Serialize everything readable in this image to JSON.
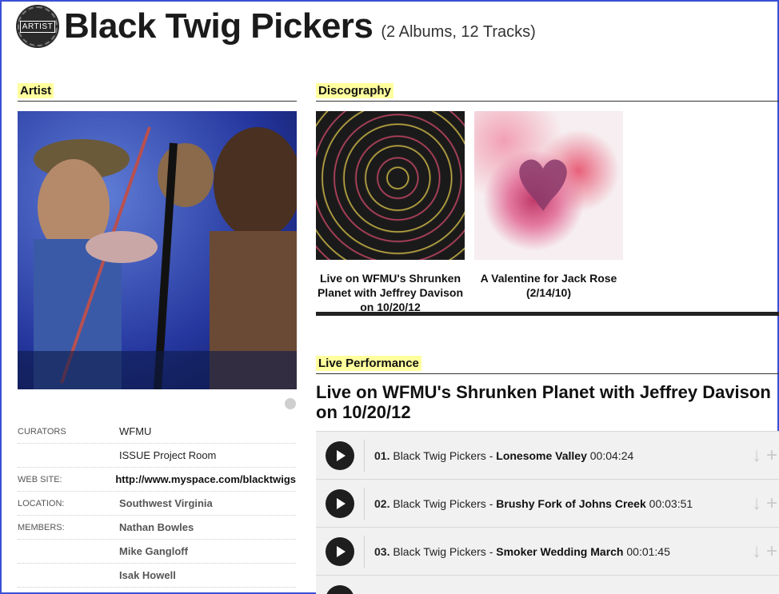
{
  "header": {
    "badge": "ARTIST",
    "title": "Black Twig Pickers",
    "counts": "(2 Albums, 12 Tracks)"
  },
  "sections": {
    "artist": "Artist",
    "discography": "Discography",
    "live": "Live Performance"
  },
  "info": [
    {
      "label": "CURATORS",
      "value": "WFMU"
    },
    {
      "label": "",
      "value": "ISSUE Project Room"
    },
    {
      "label": "WEB SITE:",
      "value": "http://www.myspace.com/blacktwigs"
    },
    {
      "label": "LOCATION:",
      "value": "Southwest Virginia"
    },
    {
      "label": "MEMBERS:",
      "value": "Nathan Bowles"
    },
    {
      "label": "",
      "value": "Mike Gangloff"
    },
    {
      "label": "",
      "value": "Isak Howell"
    }
  ],
  "albums": [
    {
      "title": "Live on WFMU's Shrunken Planet with Jeffrey Davison on 10/20/12"
    },
    {
      "title": "A Valentine for Jack Rose (2/14/10)"
    }
  ],
  "live_title": "Live on WFMU's Shrunken Planet with Jeffrey Davison on 10/20/12",
  "tracks": [
    {
      "num": "01.",
      "artist": "Black Twig Pickers",
      "sep": " - ",
      "name": "Lonesome Valley",
      "duration": "00:04:24"
    },
    {
      "num": "02.",
      "artist": "Black Twig Pickers",
      "sep": " - ",
      "name": "Brushy Fork of Johns Creek",
      "duration": "00:03:51"
    },
    {
      "num": "03.",
      "artist": "Black Twig Pickers",
      "sep": " - ",
      "name": "Smoker Wedding March",
      "duration": "00:01:45"
    }
  ],
  "icons": {
    "play": "play-icon",
    "download": "download-arrow-icon",
    "add": "plus-icon"
  }
}
